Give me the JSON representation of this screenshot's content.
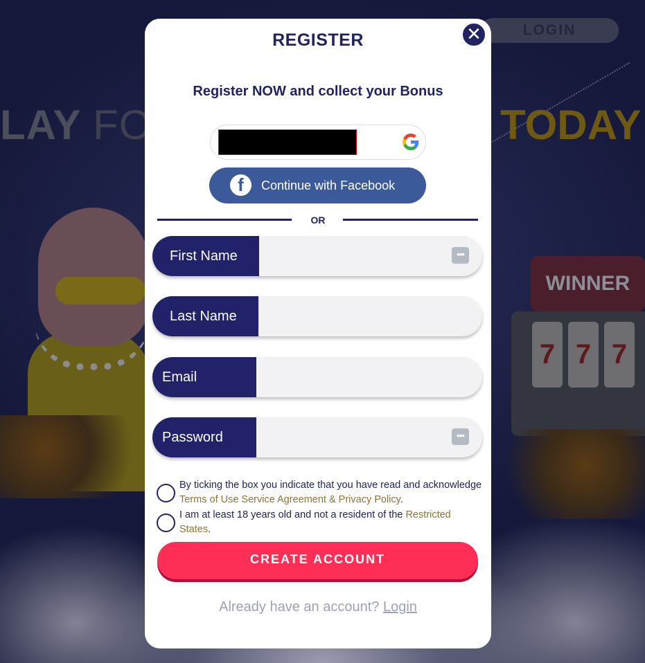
{
  "background": {
    "login_button": "LOGIN",
    "headline_left_bold": "LAY",
    "headline_left_thin": "FO",
    "headline_right": "TODAY",
    "slot_sign": "WINNER",
    "reel_symbol": "7"
  },
  "modal": {
    "title": "REGISTER",
    "close_glyph": "✕",
    "subtitle": "Register NOW and collect your Bonus",
    "facebook_label": "Continue with Facebook",
    "facebook_glyph": "f",
    "or_label": "OR",
    "fields": {
      "first_name": {
        "label": "First Name",
        "value": ""
      },
      "last_name": {
        "label": "Last Name",
        "value": ""
      },
      "email": {
        "label": "Email",
        "value": ""
      },
      "password": {
        "label": "Password",
        "value": ""
      }
    },
    "autofill_glyph": "•••",
    "terms": {
      "text_before": "By ticking the box you indicate that you have read and acknowledge ",
      "link": "Terms of Use Service Agreement & Privacy Policy",
      "text_after": "."
    },
    "age": {
      "text_before": "I am at least 18 years old and not a resident of the ",
      "link": "Restricted States",
      "text_after": "."
    },
    "create_button": "CREATE ACCOUNT",
    "already_text": "Already have an account?",
    "login_link": "Login"
  },
  "colors": {
    "brand_navy": "#22226a",
    "create_red": "#ff2e57",
    "facebook_blue": "#3c5a99",
    "link_gold": "#8a7438"
  }
}
